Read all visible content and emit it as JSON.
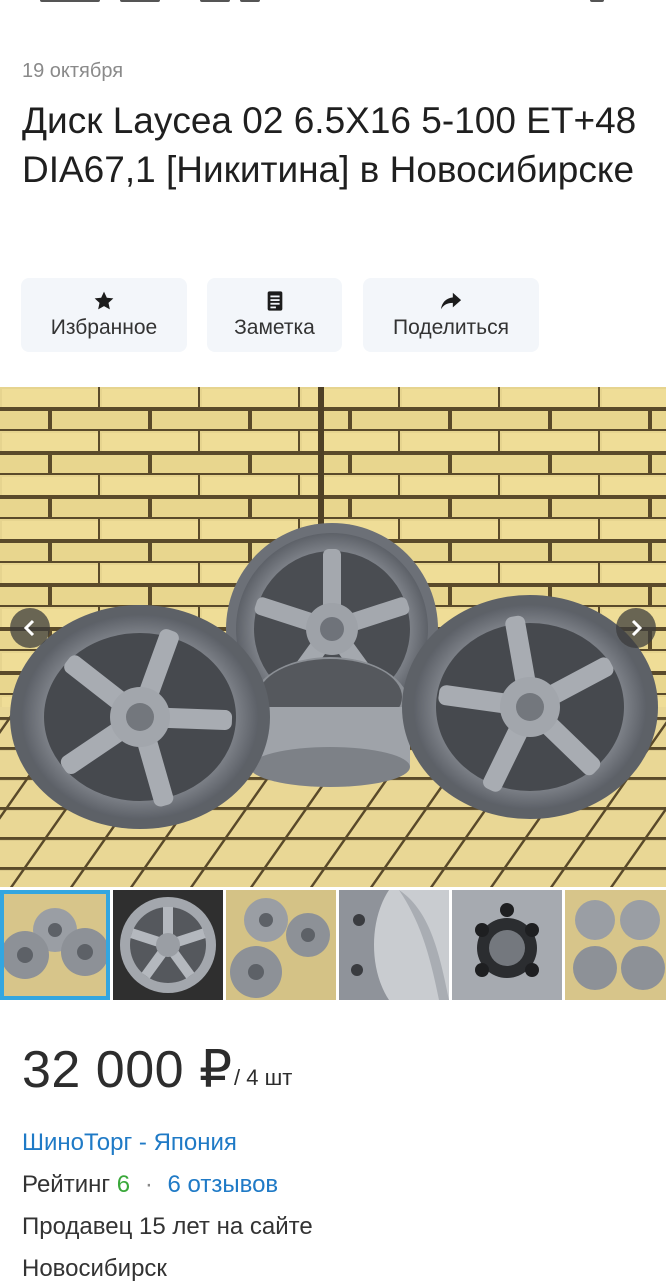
{
  "listing": {
    "date": "19 октября",
    "title": "Диск Laycea 02 6.5X16 5-100 ET+48 DIA67,1 [Никитина] в Новосибирске"
  },
  "actions": [
    {
      "label": "Избранное",
      "icon": "star-icon"
    },
    {
      "label": "Заметка",
      "icon": "note-icon"
    },
    {
      "label": "Поделиться",
      "icon": "share-icon"
    }
  ],
  "gallery": {
    "thumbnail_count": 6,
    "selected_thumbnail": 1
  },
  "price": {
    "amount": "32 000 ₽",
    "unit": "/ 4 шт"
  },
  "seller": {
    "name": "ШиноТорг - Япония",
    "rating_label": "Рейтинг",
    "rating_value": "6",
    "separator": "·",
    "reviews": "6 отзывов",
    "since": "Продавец 15 лет на сайте",
    "city": "Новосибирск"
  },
  "colors": {
    "link": "#1f7ac6",
    "rating": "#3aa83a",
    "selected_thumb": "#33a6e0",
    "button_bg": "#f3f6fa"
  }
}
